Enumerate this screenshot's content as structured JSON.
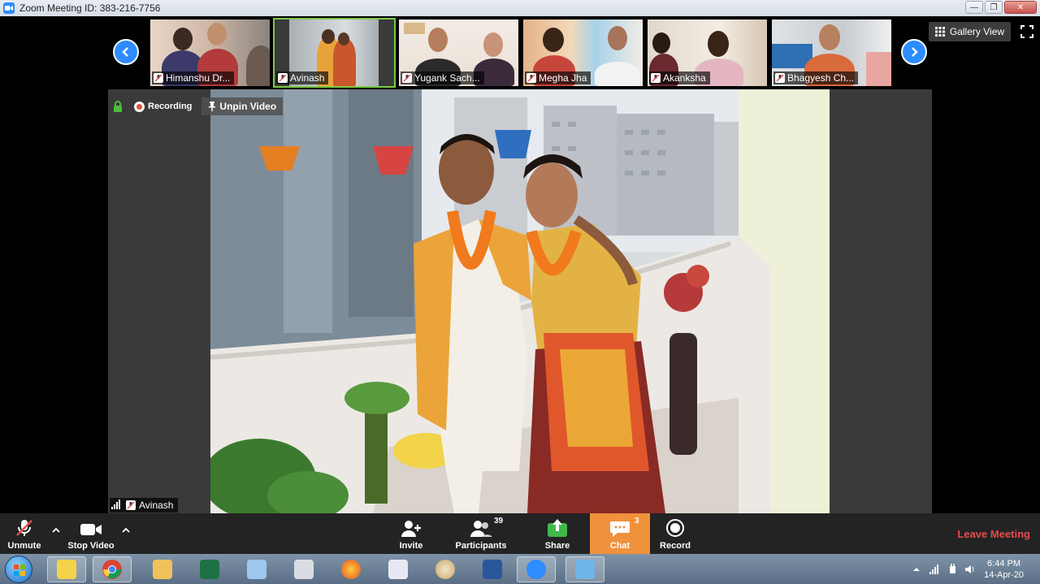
{
  "window": {
    "title": "Zoom Meeting ID: 383-216-7756"
  },
  "gallery": {
    "label": "Gallery View"
  },
  "participants_strip": [
    {
      "name": "Himanshu Dr..."
    },
    {
      "name": "Avinash"
    },
    {
      "name": "Yugank Sach..."
    },
    {
      "name": "Megha Jha"
    },
    {
      "name": "Akanksha"
    },
    {
      "name": "Bhagyesh Ch..."
    }
  ],
  "stage": {
    "recording_label": "Recording",
    "unpin_label": "Unpin Video",
    "speaker_name": "Avinash"
  },
  "toolbar": {
    "unmute": "Unmute",
    "stop_video": "Stop Video",
    "invite": "Invite",
    "participants": "Participants",
    "participants_count": "39",
    "share": "Share",
    "chat": "Chat",
    "chat_count": "3",
    "record": "Record",
    "leave": "Leave Meeting"
  },
  "taskbar": {
    "time": "6:44 PM",
    "date": "14-Apr-20"
  },
  "colors": {
    "zoom_blue": "#2d8cff",
    "active_border": "#7ac943",
    "chat_orange": "#f0913b",
    "leave_red": "#e84c4c"
  }
}
